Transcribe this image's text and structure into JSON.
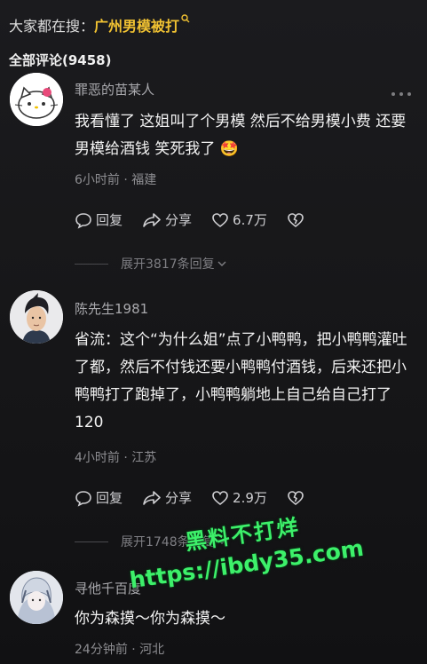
{
  "search": {
    "prefix": "大家都在搜：",
    "keyword": "广州男模被打",
    "icon": "search-icon"
  },
  "comments_header": {
    "title": "全部评论(9458)"
  },
  "comments": [
    {
      "username": "罪恶的苗某人",
      "text": "我看懂了 这姐叫了个男模 然后不给男模小费 还要男模给酒钱 笑死我了 🤩",
      "time_location": "6小时前 · 福建",
      "reply_label": "回复",
      "share_label": "分享",
      "likes": "6.7万",
      "expand_label": "展开3817条回复"
    },
    {
      "username": "陈先生1981",
      "text": "省流：这个“为什么姐”点了小鸭鸭，把小鸭鸭灌吐了都，然后不付钱还要小鸭鸭付酒钱，后来还把小鸭鸭打了跑掉了，小鸭鸭躺地上自己给自己打了120",
      "time_location": "4小时前 · 江苏",
      "reply_label": "回复",
      "share_label": "分享",
      "likes": "2.9万",
      "expand_label": "展开1748条回复"
    },
    {
      "username": "寻他千百度",
      "text": "你为森摸～你为森摸～",
      "time_location": "24分钟前 · 河北"
    }
  ],
  "watermark": {
    "line1": "黑料不打烊",
    "line2": "https://ibdy35.com",
    "color": "#3df06a"
  }
}
